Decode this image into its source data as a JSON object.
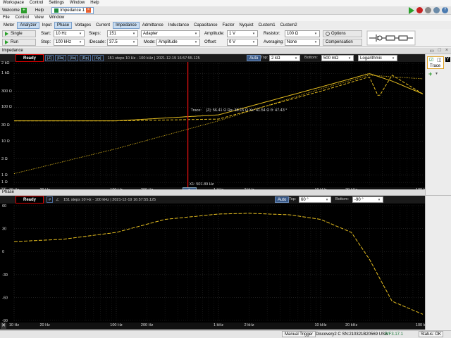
{
  "menu": [
    "Workspace",
    "Control",
    "Settings",
    "Window",
    "Help"
  ],
  "tabs": {
    "welcome": "Welcome",
    "help": "Help",
    "doc": "Impedance 1"
  },
  "submenu": [
    "File",
    "Control",
    "View",
    "Window"
  ],
  "modes": [
    "Meter",
    "Analyzer",
    "Input",
    "Phase",
    "Voltages",
    "Current",
    "Impedance",
    "Admittance",
    "Inductance",
    "Capacitance",
    "Factor",
    "Nyquist",
    "Custom1",
    "Custom2"
  ],
  "controls": {
    "single": "Single",
    "run": "Run",
    "start_label": "Start:",
    "start": "10 Hz",
    "stop_label": "Stop:",
    "stop": "100 kHz",
    "steps_label": "Steps:",
    "steps": "151",
    "decade_label": "/Decade:",
    "decade": "37.5",
    "mode_label": "Mode:",
    "mode": "Amplitude",
    "adapter": "Adapter",
    "amplitude_label": "Amplitude:",
    "amplitude": "1 V",
    "offset_label": "Offset:",
    "offset": "0 V",
    "resistor_label": "Resistor:",
    "resistor": "100 Ω",
    "averaging_label": "Averaging:",
    "averaging": "None",
    "options": "Options",
    "compensation": "Compensation"
  },
  "imp": {
    "section": "Impedance",
    "ready": "Ready",
    "buttons": [
      "|Z|",
      "|Rs|",
      "|Xs|",
      "|Rp|",
      "|Xp|"
    ],
    "info": "151 steps 10 Hz - 100 kHz | 2021-12-19 16:57:55.125",
    "auto": "Auto",
    "top_label": "Top:",
    "top": "2 kΩ",
    "bottom_label": "Bottom:",
    "bottom": "500 mΩ",
    "scale": "Logarithmic",
    "yticks": [
      "2 kΩ",
      "1 kΩ",
      "300 Ω",
      "100 Ω",
      "30 Ω",
      "10 Ω",
      "3 Ω",
      "1 Ω",
      "1 Ω"
    ],
    "xticks": [
      "10 Hz",
      "20 Hz",
      "100 Hz",
      "200 Hz",
      "1 kHz",
      "2 kHz",
      "10 kHz",
      "20 kHz",
      "100 kHz"
    ],
    "trace": "Trace:",
    "readout": "|Z|: 56.41 Ω  Rs: 38.15 Ω  Xs: 41.54 Ω  θ: 47.43 °",
    "cursor": "X1: 501.89 Hz",
    "cursor_idx": "1"
  },
  "phase": {
    "section": "Phase",
    "ready": "Ready",
    "hash": "#",
    "info": "151 steps 10 Hz - 100 kHz | 2021-12-19 16:57:55.125",
    "auto": "Auto",
    "top_label": "Top:",
    "top": "60 °",
    "bottom_label": "Bottom:",
    "bottom": "-90 °",
    "yticks": [
      "60",
      "30",
      "0",
      "-30",
      "-60",
      "-90"
    ],
    "xticks": [
      "10 Hz",
      "20 Hz",
      "100 Hz",
      "200 Hz",
      "1 kHz",
      "2 kHz",
      "10 kHz",
      "20 kHz",
      "100 kHz"
    ]
  },
  "side": {
    "trace": "Trace"
  },
  "status": {
    "manual": "Manual Trigger",
    "device": "Discovery2 C SN:210321B20569 USB",
    "wf": "WF3.17.1",
    "status": "Status: OK"
  },
  "colors": {
    "trace": "#e8c020",
    "cursor": "#e01010",
    "accent": "#3a7ad0"
  },
  "chart_data": [
    {
      "type": "line",
      "title": "",
      "xlabel": "",
      "ylabel": "",
      "xscale": "log",
      "yscale": "log",
      "xlim": [
        10,
        100000
      ],
      "ylim": [
        0.5,
        2000
      ],
      "series": [
        {
          "values_at": [
            10,
            100,
            1000,
            10000,
            30000,
            50000,
            100000
          ],
          "values": [
            40,
            40,
            60,
            400,
            1000,
            600,
            250
          ]
        },
        {
          "values_at": [
            10,
            100,
            1000,
            10000,
            30000,
            37000,
            50000,
            100000
          ],
          "values": [
            40,
            40,
            45,
            300,
            800,
            200,
            900,
            250
          ]
        },
        {
          "values_at": [
            10,
            100,
            1000,
            10000,
            30000,
            50000,
            100000
          ],
          "values": [
            1.1,
            6,
            40,
            350,
            900,
            800,
            700
          ]
        }
      ]
    },
    {
      "type": "line",
      "title": "",
      "xlabel": "",
      "ylabel": "",
      "xscale": "log",
      "xlim": [
        10,
        100000
      ],
      "ylim": [
        -90,
        60
      ],
      "series": [
        {
          "values_at": [
            10,
            30,
            100,
            300,
            1000,
            2000,
            5000,
            10000,
            20000,
            30000,
            50000,
            100000
          ],
          "values": [
            13,
            16,
            25,
            42,
            49,
            50,
            48,
            42,
            25,
            -10,
            -65,
            -82
          ]
        }
      ]
    }
  ]
}
